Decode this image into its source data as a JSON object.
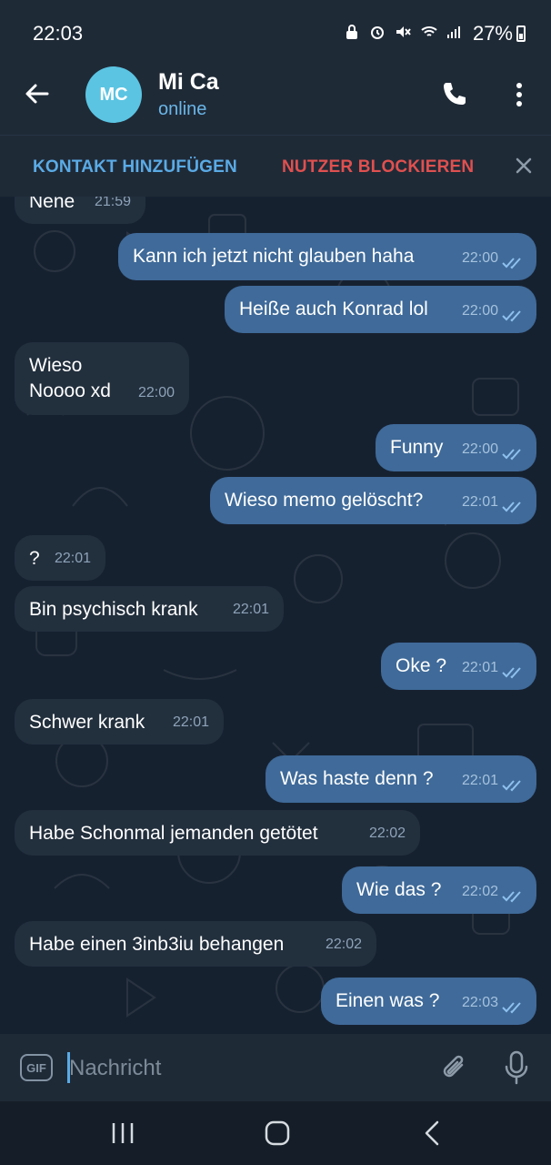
{
  "status": {
    "time": "22:03",
    "battery": "27%"
  },
  "header": {
    "avatar_initials": "MC",
    "name": "Mi Ca",
    "status": "online"
  },
  "actions": {
    "add_contact": "KONTAKT HINZUFÜGEN",
    "block_user": "NUTZER BLOCKIEREN"
  },
  "messages": [
    {
      "dir": "in",
      "text": "Nene",
      "time": "21:59"
    },
    {
      "dir": "out",
      "text": "Kann ich jetzt nicht glauben haha",
      "time": "22:00",
      "read": true
    },
    {
      "dir": "out",
      "text": "Heiße auch Konrad lol",
      "time": "22:00",
      "read": true
    },
    {
      "dir": "in",
      "text": "Wieso\nNoooo xd",
      "time": "22:00"
    },
    {
      "dir": "out",
      "text": "Funny",
      "time": "22:00",
      "read": true
    },
    {
      "dir": "out",
      "text": "Wieso memo gelöscht?",
      "time": "22:01",
      "read": true
    },
    {
      "dir": "in",
      "text": "?",
      "time": "22:01"
    },
    {
      "dir": "in",
      "text": "Bin psychisch krank",
      "time": "22:01"
    },
    {
      "dir": "out",
      "text": "Oke ?",
      "time": "22:01",
      "read": true
    },
    {
      "dir": "in",
      "text": "Schwer krank",
      "time": "22:01"
    },
    {
      "dir": "out",
      "text": "Was haste denn ?",
      "time": "22:01",
      "read": true
    },
    {
      "dir": "in",
      "text": "Habe Schonmal jemanden getötet",
      "time": "22:02"
    },
    {
      "dir": "out",
      "text": "Wie das ?",
      "time": "22:02",
      "read": true
    },
    {
      "dir": "in",
      "text": "Habe einen 3inb3iu behangen",
      "time": "22:02"
    },
    {
      "dir": "out",
      "text": "Einen was ?",
      "time": "22:03",
      "read": true
    }
  ],
  "input": {
    "gif_label": "GIF",
    "placeholder": "Nachricht"
  },
  "icons": {
    "back": "arrow-left-icon",
    "call": "phone-icon",
    "more": "more-vert-icon",
    "close": "close-icon",
    "attach": "paperclip-icon",
    "mic": "microphone-icon",
    "read": "double-check-icon"
  },
  "colors": {
    "incoming_bubble": "#222f3d",
    "outgoing_bubble": "#3f6a99",
    "accent": "#5aabe6",
    "danger": "#e0504f"
  }
}
